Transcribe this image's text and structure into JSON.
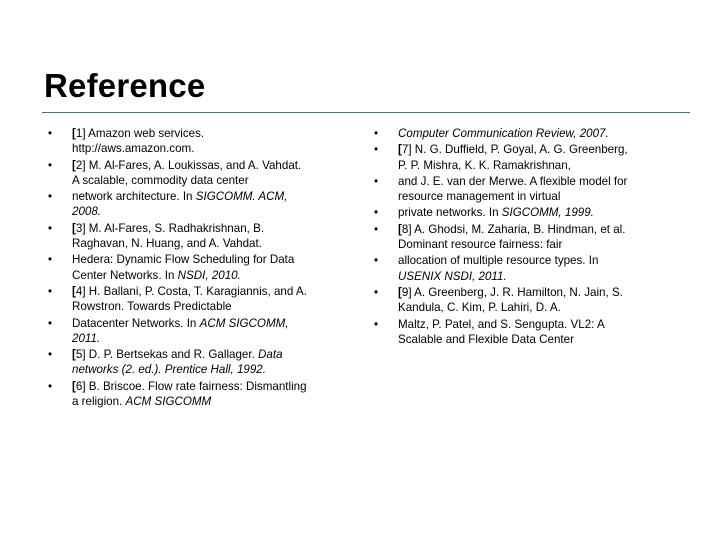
{
  "slide": {
    "title": "Reference",
    "divider_color": "#46708a",
    "background_color": "#ffffff",
    "text_color": "#000000",
    "bullet_glyph": "•"
  },
  "columns": [
    {
      "name": "left",
      "items": [
        {
          "bullet": "•",
          "runs": [
            {
              "text": "[",
              "style": "bold"
            },
            {
              "text": "1",
              "style": "normal"
            },
            {
              "text": "] Amazon web services.\nhttp://aws.amazon.com.",
              "style": "normal"
            }
          ]
        },
        {
          "bullet": "•",
          "runs": [
            {
              "text": "[",
              "style": "bold"
            },
            {
              "text": "2",
              "style": "normal"
            },
            {
              "text": "] M. Al-Fares, A. Loukissas, and A. Vahdat.\nA scalable, commodity data center",
              "style": "normal"
            }
          ]
        },
        {
          "bullet": "•",
          "runs": [
            {
              "text": "network architecture. In ",
              "style": "normal"
            },
            {
              "text": "SIGCOMM. ACM,\n2008.",
              "style": "italic"
            }
          ]
        },
        {
          "bullet": "•",
          "runs": [
            {
              "text": "[",
              "style": "bold"
            },
            {
              "text": "3",
              "style": "normal"
            },
            {
              "text": "] M. Al-Fares, S. Radhakrishnan, B.\nRaghavan, N. Huang, and A. Vahdat.",
              "style": "normal"
            }
          ]
        },
        {
          "bullet": "•",
          "runs": [
            {
              "text": "Hedera: Dynamic Flow Scheduling for Data\nCenter Networks. In ",
              "style": "normal"
            },
            {
              "text": "NSDI, 2010.",
              "style": "italic"
            }
          ]
        },
        {
          "bullet": "•",
          "runs": [
            {
              "text": "[",
              "style": "bold"
            },
            {
              "text": "4",
              "style": "normal"
            },
            {
              "text": "] H. Ballani, P. Costa, T. Karagiannis, and A.\nRowstron. Towards Predictable",
              "style": "normal"
            }
          ]
        },
        {
          "bullet": "•",
          "runs": [
            {
              "text": "Datacenter Networks. In ",
              "style": "normal"
            },
            {
              "text": "ACM SIGCOMM,\n2011.",
              "style": "italic"
            }
          ]
        },
        {
          "bullet": "•",
          "runs": [
            {
              "text": "[",
              "style": "bold"
            },
            {
              "text": "5",
              "style": "normal"
            },
            {
              "text": "] D. P. Bertsekas and R. Gallager. ",
              "style": "normal"
            },
            {
              "text": "Data\nnetworks (2. ed.). Prentice Hall, 1992.",
              "style": "italic"
            }
          ]
        },
        {
          "bullet": "•",
          "runs": [
            {
              "text": "[",
              "style": "bold"
            },
            {
              "text": "6",
              "style": "normal"
            },
            {
              "text": "] B. Briscoe. Flow rate fairness: Dismantling\na religion. ",
              "style": "normal"
            },
            {
              "text": "ACM SIGCOMM",
              "style": "italic"
            }
          ]
        }
      ]
    },
    {
      "name": "right",
      "items": [
        {
          "bullet": "•",
          "runs": [
            {
              "text": "Computer Communication Review, 2007.",
              "style": "italic"
            }
          ]
        },
        {
          "bullet": "•",
          "runs": [
            {
              "text": "[",
              "style": "bold"
            },
            {
              "text": "7",
              "style": "normal"
            },
            {
              "text": "] N. G. Duffield, P. Goyal, A. G. Greenberg,\nP. P. Mishra, K. K. Ramakrishnan,",
              "style": "normal"
            }
          ]
        },
        {
          "bullet": "•",
          "runs": [
            {
              "text": "and J. E. van der Merwe. A flexible model for\nresource management in virtual",
              "style": "normal"
            }
          ]
        },
        {
          "bullet": "•",
          "runs": [
            {
              "text": "private networks. In ",
              "style": "normal"
            },
            {
              "text": "SIGCOMM, 1999.",
              "style": "italic"
            }
          ]
        },
        {
          "bullet": "•",
          "runs": [
            {
              "text": "[",
              "style": "bold"
            },
            {
              "text": "8",
              "style": "normal"
            },
            {
              "text": "] A. Ghodsi, M. Zaharia, B. Hindman, et al.\nDominant resource fairness: fair",
              "style": "normal"
            }
          ]
        },
        {
          "bullet": "•",
          "runs": [
            {
              "text": "allocation of multiple resource types. In\n",
              "style": "normal"
            },
            {
              "text": "USENIX NSDI, 2011.",
              "style": "italic"
            }
          ]
        },
        {
          "bullet": "•",
          "runs": [
            {
              "text": "[",
              "style": "bold"
            },
            {
              "text": "9",
              "style": "normal"
            },
            {
              "text": "] A. Greenberg, J. R. Hamilton, N. Jain, S.\nKandula, C. Kim, P. Lahiri, D. A.",
              "style": "normal"
            }
          ]
        },
        {
          "bullet": "•",
          "runs": [
            {
              "text": "Maltz, P. Patel, and S. Sengupta. VL2: A\nScalable and Flexible Data Center",
              "style": "normal"
            }
          ]
        }
      ]
    }
  ]
}
